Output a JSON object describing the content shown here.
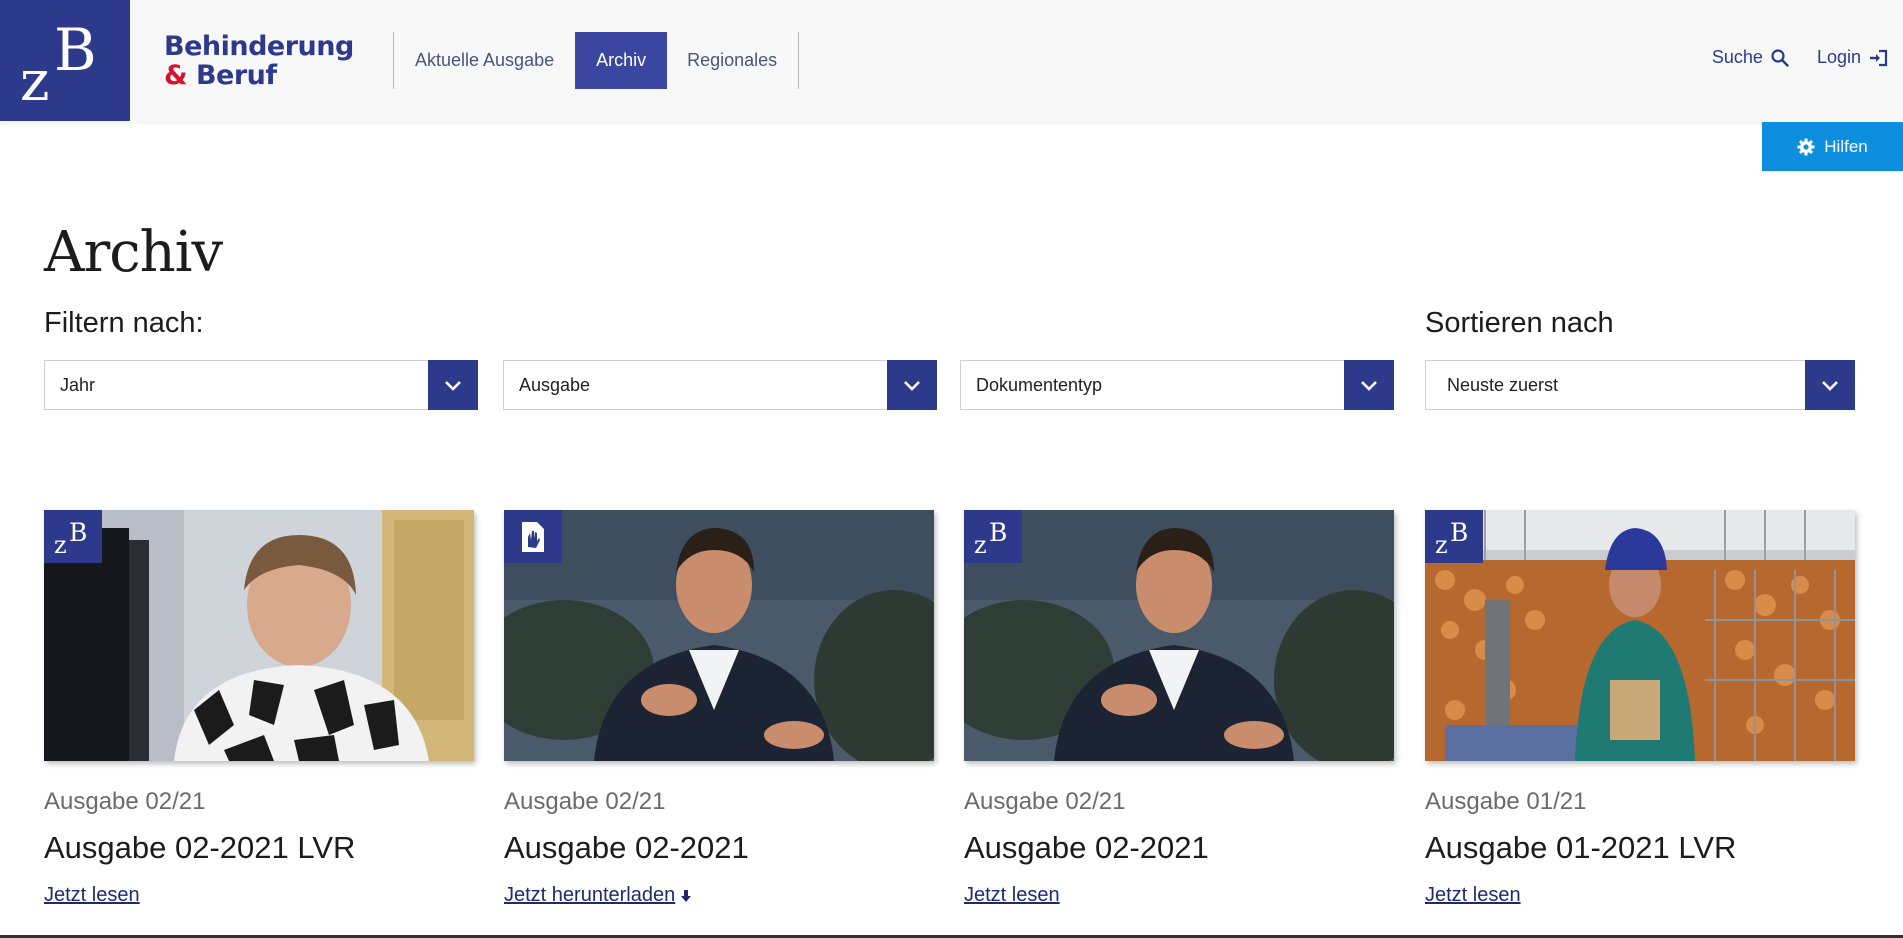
{
  "header": {
    "brand_line1": "Behinderung",
    "brand_amp": "&",
    "brand_line2": "Beruf",
    "nav": [
      {
        "label": "Aktuelle Ausgabe",
        "active": false
      },
      {
        "label": "Archiv",
        "active": true
      },
      {
        "label": "Regionales",
        "active": false
      }
    ],
    "search_label": "Suche",
    "login_label": "Login",
    "help_label": "Hilfen"
  },
  "main": {
    "title": "Archiv",
    "filter_label": "Filtern nach:",
    "sort_label": "Sortieren nach",
    "filters": [
      "Jahr",
      "Ausgabe",
      "Dokumententyp"
    ],
    "sort_value": "Neuste zuerst"
  },
  "cards": [
    {
      "kicker": "Ausgabe 02/21",
      "title": "Ausgabe 02-2021 LVR",
      "link": "Jetzt lesen",
      "badge": "zb-logo-icon",
      "image": "woman at computer"
    },
    {
      "kicker": "Ausgabe 02/21",
      "title": "Ausgabe 02-2021",
      "link": "Jetzt herunterladen",
      "badge": "sign-language-document-icon",
      "image": "man in suit gesturing"
    },
    {
      "kicker": "Ausgabe 02/21",
      "title": "Ausgabe 02-2021",
      "link": "Jetzt lesen",
      "badge": "zb-logo-icon",
      "image": "man in suit gesturing"
    },
    {
      "kicker": "Ausgabe 01/21",
      "title": "Ausgabe 01-2021 LVR",
      "link": "Jetzt lesen",
      "badge": "zb-logo-icon",
      "image": "worker at firewood splitter"
    }
  ],
  "colors": {
    "brand_blue": "#2d3a8c",
    "nav_active": "#3a46a0",
    "accent_red": "#d7132b",
    "help_blue": "#0d8ede"
  }
}
